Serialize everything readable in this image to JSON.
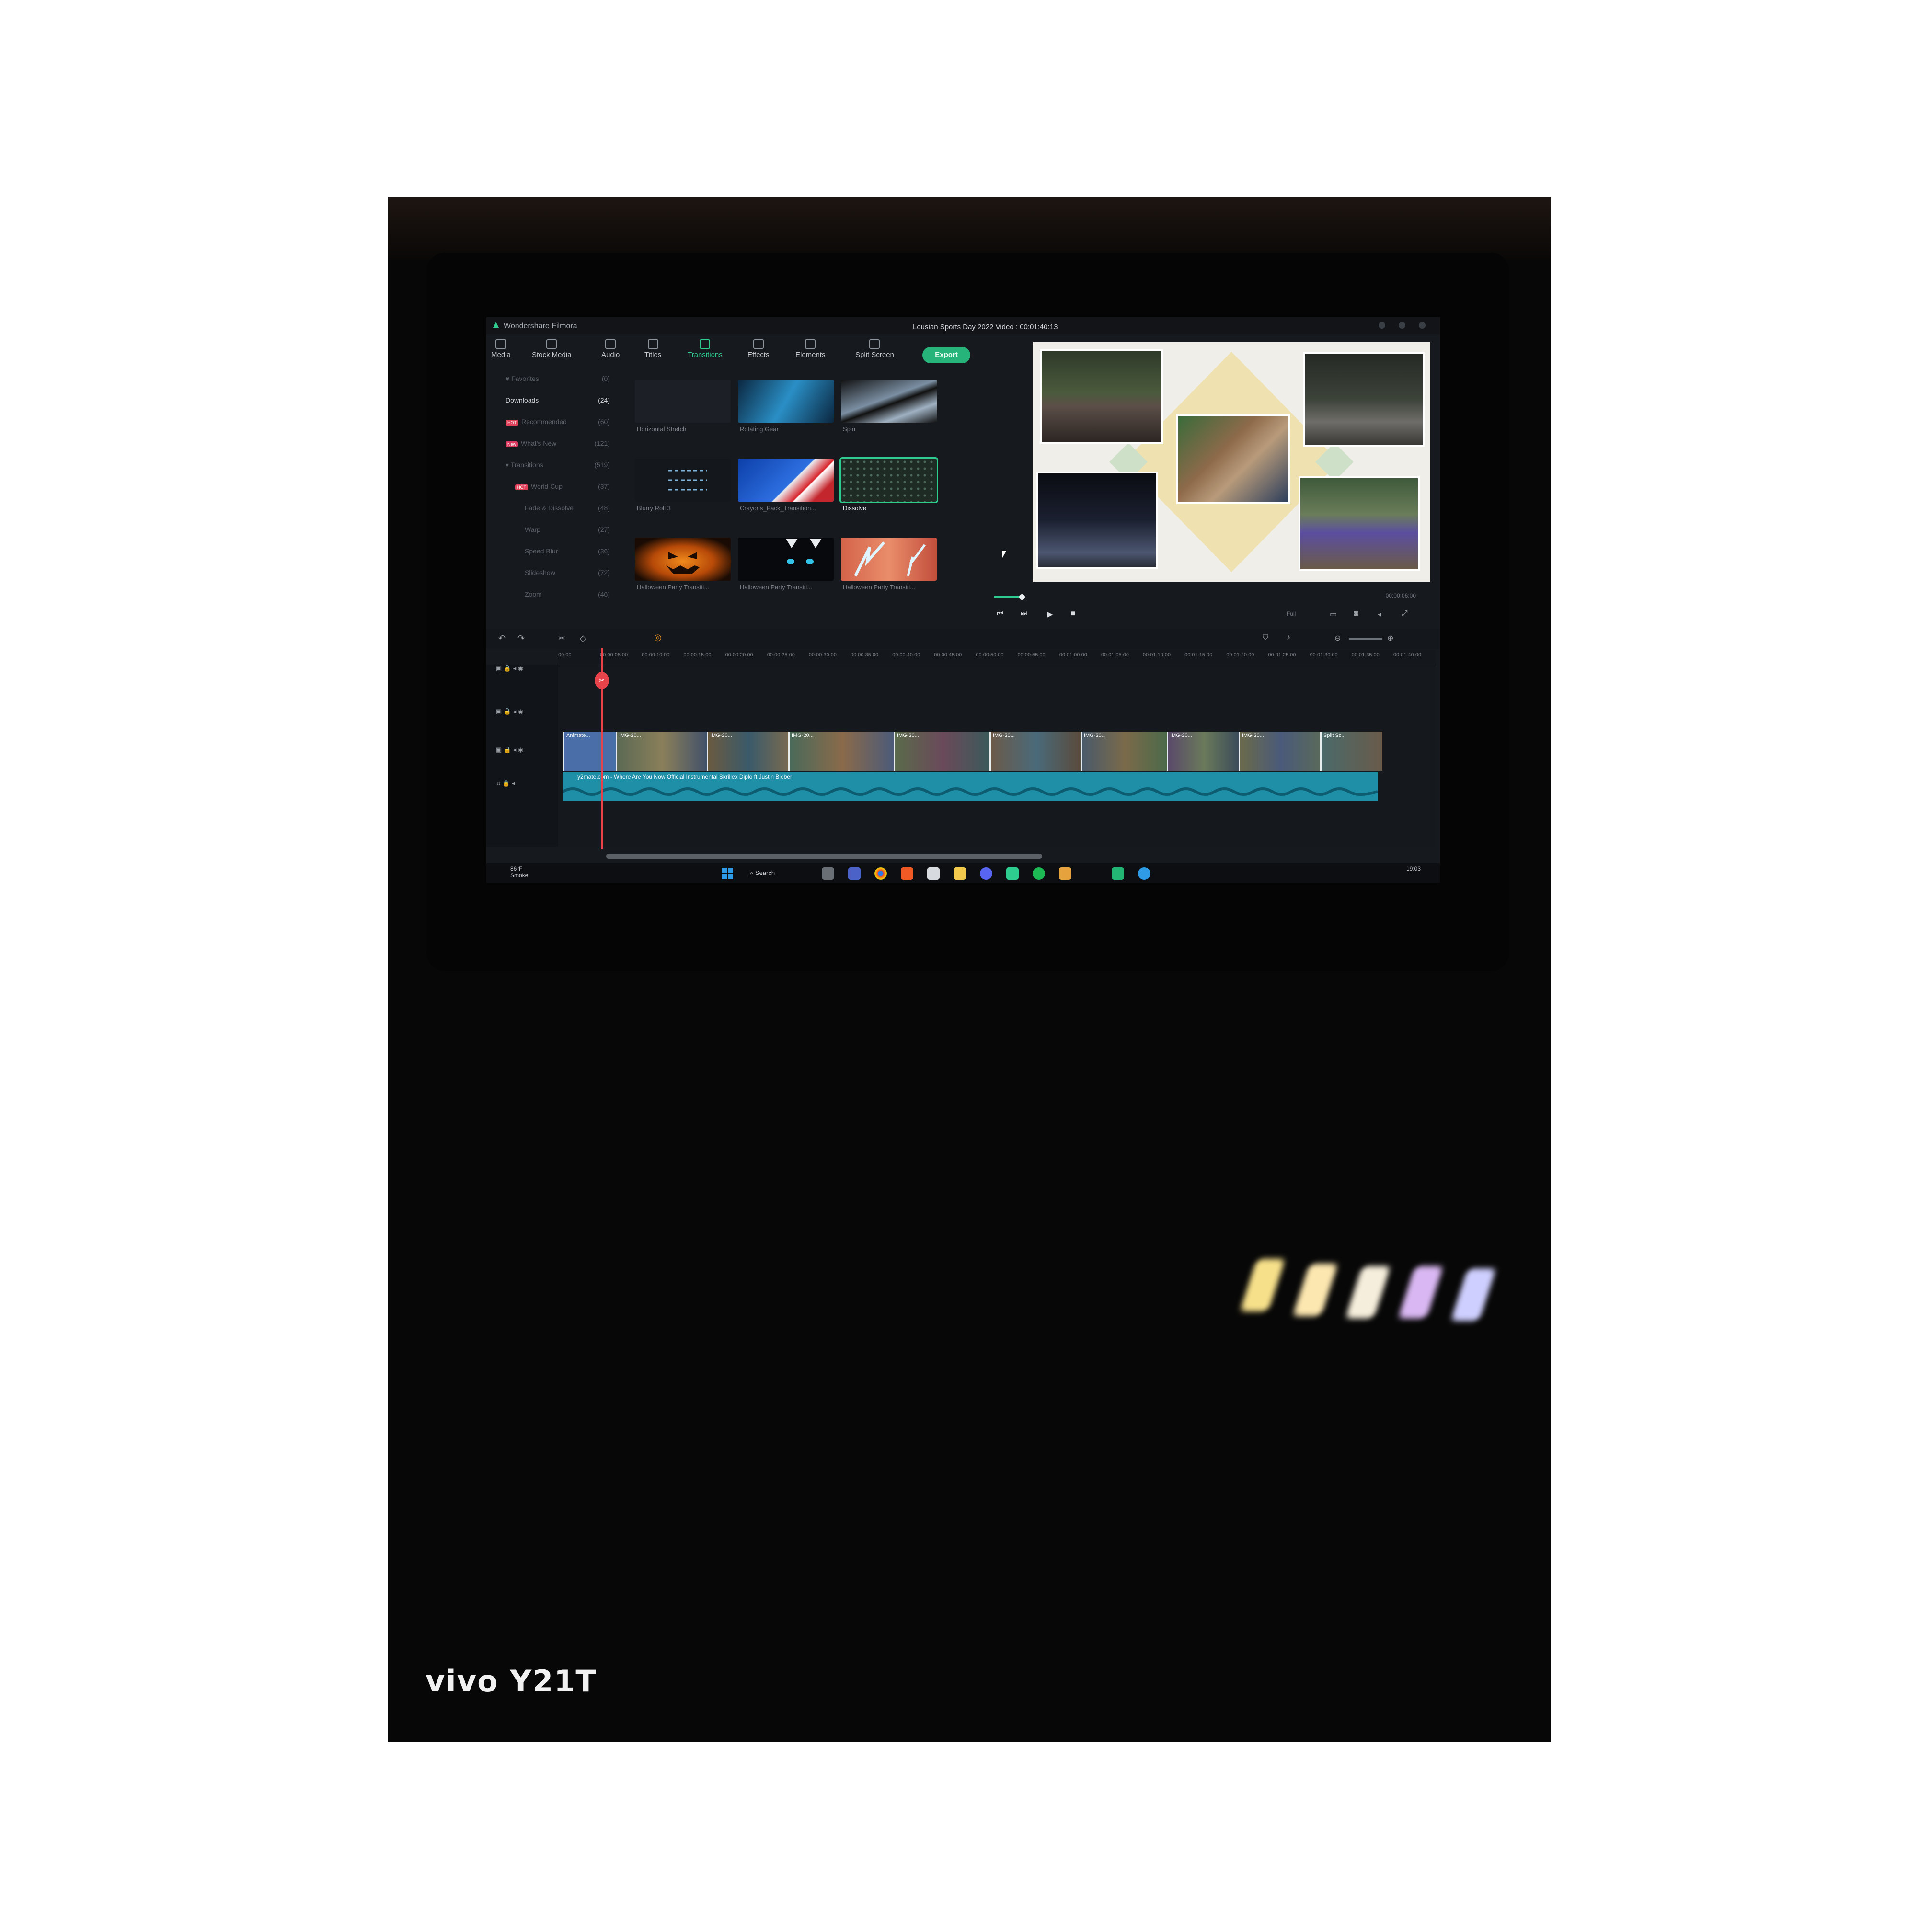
{
  "app": {
    "name": "Wondershare Filmora",
    "project_title": "Lousian Sports Day 2022 Video : 00:01:40:13",
    "export_label": "Export"
  },
  "toolbar": {
    "tabs": [
      {
        "label": "Media",
        "icon": "media-icon"
      },
      {
        "label": "Stock Media",
        "icon": "cloud-icon"
      },
      {
        "label": "Audio",
        "icon": "music-icon"
      },
      {
        "label": "Titles",
        "icon": "text-icon"
      },
      {
        "label": "Transitions",
        "icon": "transition-icon",
        "active": true
      },
      {
        "label": "Effects",
        "icon": "sparkle-icon"
      },
      {
        "label": "Elements",
        "icon": "shapes-icon"
      },
      {
        "label": "Split Screen",
        "icon": "split-icon"
      }
    ]
  },
  "sidebar": {
    "categories": [
      {
        "label": "Favorites",
        "count": "(0)"
      },
      {
        "label": "Downloads",
        "count": "(24)",
        "selected": true
      },
      {
        "label": "Recommended",
        "count": "(60)",
        "tag": "HOT"
      },
      {
        "label": "What's New",
        "count": "(121)",
        "tag": "New"
      },
      {
        "label": "Transitions",
        "count": "(519)"
      },
      {
        "label": "World Cup",
        "count": "(37)",
        "tag": "HOT"
      },
      {
        "label": "Fade & Dissolve",
        "count": "(48)"
      },
      {
        "label": "Warp",
        "count": "(27)"
      },
      {
        "label": "Speed Blur",
        "count": "(36)"
      },
      {
        "label": "Slideshow",
        "count": "(72)"
      },
      {
        "label": "Zoom",
        "count": "(46)"
      }
    ]
  },
  "transitions": {
    "items": [
      {
        "label": "Horizontal Stretch"
      },
      {
        "label": "Rotating Gear"
      },
      {
        "label": "Spin"
      },
      {
        "label": "Blurry Roll 3"
      },
      {
        "label": "Crayons_Pack_Transition..."
      },
      {
        "label": "Dissolve",
        "selected": true
      },
      {
        "label": "Halloween Party Transiti..."
      },
      {
        "label": "Halloween Party Transiti..."
      },
      {
        "label": "Halloween Party Transiti..."
      }
    ]
  },
  "player": {
    "timecode": "00:00:06:00",
    "quality": "Full"
  },
  "timeline": {
    "ruler_ticks": [
      "00:00",
      "00:00:05:00",
      "00:00:10:00",
      "00:00:15:00",
      "00:00:20:00",
      "00:00:25:00",
      "00:00:30:00",
      "00:00:35:00",
      "00:00:40:00",
      "00:00:45:00",
      "00:00:50:00",
      "00:00:55:00",
      "00:01:00:00",
      "00:01:05:00",
      "00:01:10:00",
      "00:01:15:00",
      "00:01:20:00",
      "00:01:25:00",
      "00:01:30:00",
      "00:01:35:00",
      "00:01:40:00"
    ],
    "clips": [
      "Animate...",
      "IMG-20...",
      "IMG-20...",
      "IMG-20...",
      "IMG-20...",
      "IMG-20...",
      "IMG-20...",
      "IMG-20...",
      "IMG-20...",
      "Split Sc..."
    ],
    "audio_label": "y2mate.com - Where Are You Now Official Instrumental  Skrillex  Diplo ft Justin Bieber"
  },
  "taskbar": {
    "weather_temp": "86°F",
    "weather_desc": "Smoke",
    "search_label": "Search",
    "clock": "19:03"
  },
  "photo": {
    "watermark": "vivo Y21T"
  }
}
